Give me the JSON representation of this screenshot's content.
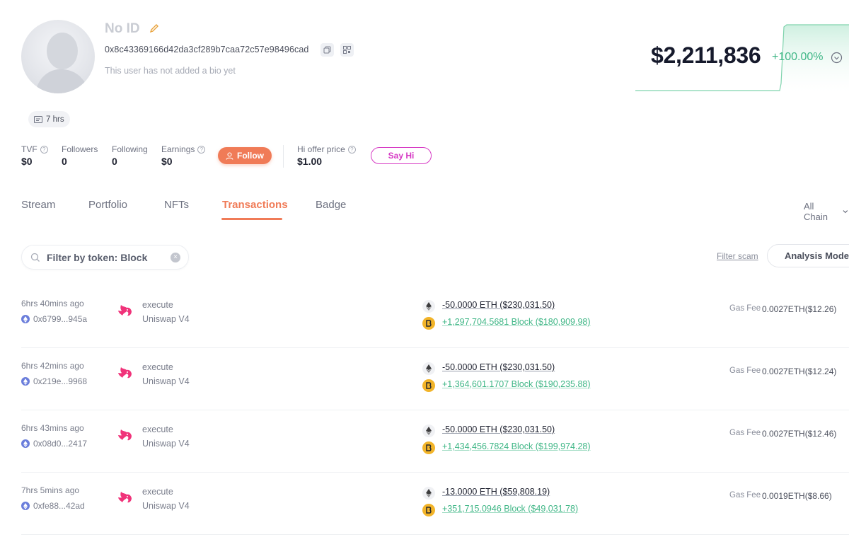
{
  "profile": {
    "name": "No ID",
    "address": "0x8c43369166d42da3cf289b7caa72c57e98496cad",
    "bio": "This user has not added a bio yet",
    "age_chip": "7 hrs"
  },
  "balance": {
    "value": "$2,211,836",
    "change": "+100.00%",
    "change_color": "#3fb686"
  },
  "stats": {
    "tvf_label": "TVF",
    "tvf_value": "$0",
    "followers_label": "Followers",
    "followers_value": "0",
    "following_label": "Following",
    "following_value": "0",
    "earnings_label": "Earnings",
    "earnings_value": "$0",
    "follow_button": "Follow",
    "hi_offer_label": "Hi offer price",
    "hi_offer_value": "$1.00",
    "say_hi_button": "Say Hi"
  },
  "tabs": [
    {
      "label": "Stream"
    },
    {
      "label": "Portfolio"
    },
    {
      "label": "NFTs"
    },
    {
      "label": "Transactions",
      "active": true
    },
    {
      "label": "Badge"
    }
  ],
  "chain_select": "All Chain",
  "filter": {
    "placeholder": "Filter by token: Block",
    "filter_scam": "Filter scam",
    "analysis_mode": "Analysis Mode"
  },
  "accent_color": "#f07b57",
  "transactions": [
    {
      "time": "6hrs 40mins ago",
      "hash": "0x6799...945a",
      "method": "execute",
      "protocol": "Uniswap V4",
      "out": "-50.0000 ETH ($230,031.50)",
      "in": "+1,297,704.5681 Block ($180,909.98)",
      "gas_label": "Gas Fee",
      "gas": "0.0027ETH($12.26)"
    },
    {
      "time": "6hrs 42mins ago",
      "hash": "0x219e...9968",
      "method": "execute",
      "protocol": "Uniswap V4",
      "out": "-50.0000 ETH ($230,031.50)",
      "in": "+1,364,601.1707 Block ($190,235.88)",
      "gas_label": "Gas Fee",
      "gas": "0.0027ETH($12.24)"
    },
    {
      "time": "6hrs 43mins ago",
      "hash": "0x08d0...2417",
      "method": "execute",
      "protocol": "Uniswap V4",
      "out": "-50.0000 ETH ($230,031.50)",
      "in": "+1,434,456.7824 Block ($199,974.28)",
      "gas_label": "Gas Fee",
      "gas": "0.0027ETH($12.46)"
    },
    {
      "time": "7hrs 5mins ago",
      "hash": "0xfe88...42ad",
      "method": "execute",
      "protocol": "Uniswap V4",
      "out": "-13.0000 ETH ($59,808.19)",
      "in": "+351,715.0946 Block ($49,031.78)",
      "gas_label": "Gas Fee",
      "gas": "0.0019ETH($8.66)"
    }
  ]
}
